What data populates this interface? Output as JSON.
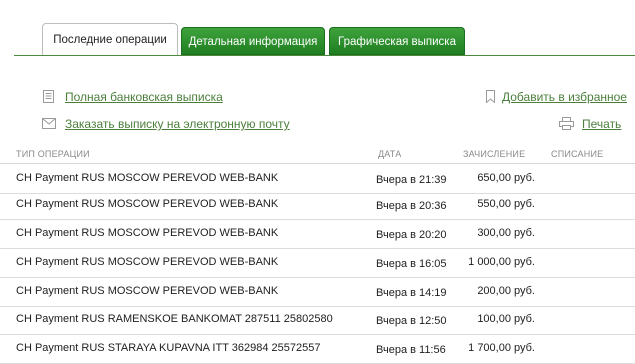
{
  "tabs": [
    {
      "label": "Последние операции",
      "active": true
    },
    {
      "label": "Детальная информация",
      "active": false
    },
    {
      "label": "Графическая выписка",
      "active": false
    }
  ],
  "actions": {
    "full_statement": "Полная банковская выписка",
    "email_statement": "Заказать выписку на электронную почту",
    "add_favorite": "Добавить в избранное",
    "print": "Печать"
  },
  "table": {
    "headers": {
      "type": "ТИП ОПЕРАЦИИ",
      "date": "ДАТА",
      "credit": "ЗАЧИСЛЕНИЕ",
      "debit": "СПИСАНИЕ"
    },
    "rows": [
      {
        "type": "CH Payment RUS MOSCOW PEREVOD WEB-BANK",
        "date": "Вчера в 21:39",
        "credit": "650,00 руб.",
        "debit": ""
      },
      {
        "type": "CH Payment RUS MOSCOW PEREVOD WEB-BANK",
        "date": "Вчера в 20:36",
        "credit": "550,00 руб.",
        "debit": ""
      },
      {
        "type": "CH Payment RUS MOSCOW PEREVOD WEB-BANK",
        "date": "Вчера в 20:20",
        "credit": "300,00 руб.",
        "debit": ""
      },
      {
        "type": "CH Payment RUS MOSCOW PEREVOD WEB-BANK",
        "date": "Вчера в 16:05",
        "credit": "1 000,00 руб.",
        "debit": ""
      },
      {
        "type": "CH Payment RUS MOSCOW PEREVOD WEB-BANK",
        "date": "Вчера в 14:19",
        "credit": "200,00 руб.",
        "debit": ""
      },
      {
        "type": "CH Payment RUS RAMENSKOE BANKOMAT 287511 25802580",
        "date": "Вчера в 12:50",
        "credit": "100,00 руб.",
        "debit": ""
      },
      {
        "type": "CH Payment RUS STARAYA KUPAVNA ITT 362984 25572557",
        "date": "Вчера в 11:56",
        "credit": "1 700,00 руб.",
        "debit": ""
      }
    ]
  },
  "colors": {
    "accent_green": "#1f7e22",
    "link_green": "#4b7e3b"
  }
}
